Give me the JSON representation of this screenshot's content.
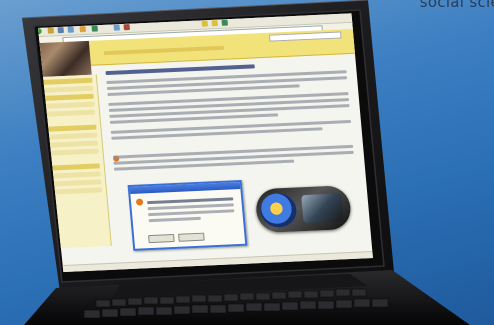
{
  "caption": {
    "text": "social scie"
  },
  "scene": {
    "subject": "laptop-photo",
    "background_color": "#3d7fc2",
    "laptop_body_color": "#1b1b1d",
    "screen_accent_color": "#f2e27a",
    "window_titlebar_color": "#2a5bc4",
    "icons": [
      "laptop-icon",
      "browser-window-icon",
      "dialog-box-icon",
      "media-device-icon",
      "keyboard-icon"
    ]
  }
}
